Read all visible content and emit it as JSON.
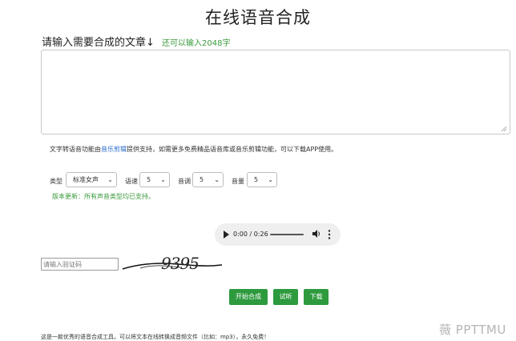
{
  "page": {
    "title": "在线语音合成"
  },
  "prompt": {
    "label": "请输入需要合成的文章↓",
    "char_limit": "还可以输入2048字"
  },
  "text_area": {
    "value": ""
  },
  "info": {
    "prefix": "文字转语音功能由",
    "link": "音乐剪辑",
    "suffix": "提供支持，如需更多免费精品语音库或音乐剪辑功能，可以下载APP使用。"
  },
  "controls": {
    "type_label": "类型",
    "type_value": "标准女声",
    "speed_label": "语速",
    "speed_value": "5",
    "pitch_label": "音调",
    "pitch_value": "5",
    "volume_label": "音量",
    "volume_value": "5"
  },
  "update_note": "版本更新：所有声音类型均已支持。",
  "audio": {
    "time": "0:00 / 0:26"
  },
  "captcha": {
    "placeholder": "请输入验证码",
    "image_text": "9395"
  },
  "buttons": {
    "start": "开始合成",
    "preview": "试听",
    "download": "下载"
  },
  "footer": "这是一款优秀的语音合成工具，可以将文本在线转换成音频文件（比如：mp3），永久免费！",
  "watermark": "薇 PPTTMU",
  "colors": {
    "green": "#2e9a3e",
    "link_blue": "#2a6ed0"
  }
}
